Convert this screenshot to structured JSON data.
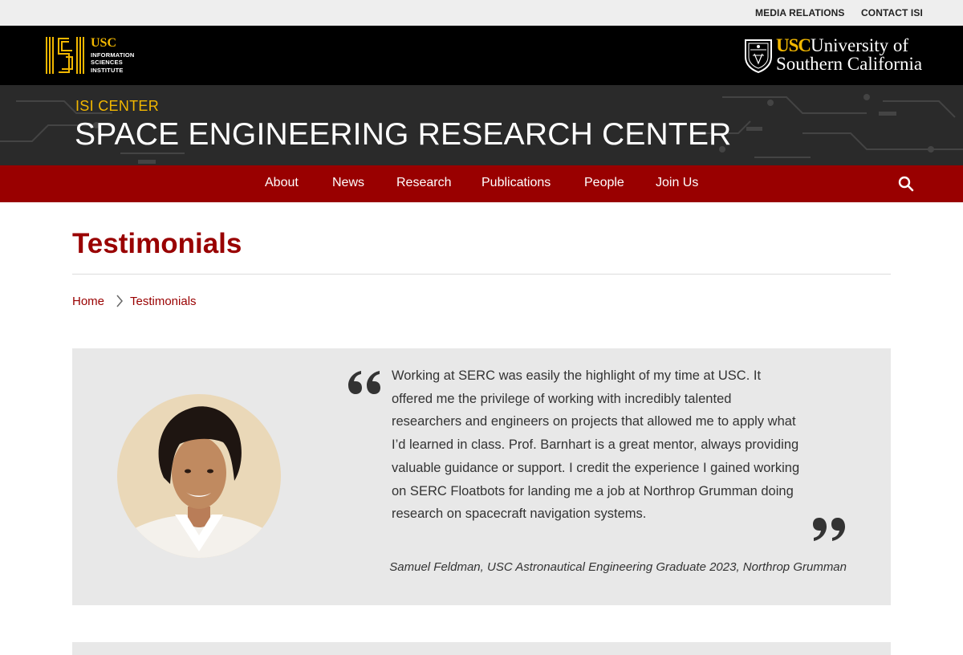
{
  "utility": {
    "media_relations": "MEDIA RELATIONS",
    "contact_isi": "CONTACT ISI"
  },
  "header": {
    "isi_logo": {
      "usc": "USC",
      "line1": "INFORMATION",
      "line2": "SCIENCES",
      "line3": "INSTITUTE"
    },
    "usc_logo": {
      "abbr": "USC",
      "line1": "University of",
      "line2": "Southern California"
    }
  },
  "banner": {
    "kicker": "ISI CENTER",
    "title": "SPACE ENGINEERING RESEARCH CENTER"
  },
  "nav": {
    "items": [
      {
        "label": "About"
      },
      {
        "label": "News"
      },
      {
        "label": "Research"
      },
      {
        "label": "Publications"
      },
      {
        "label": "People"
      },
      {
        "label": "Join Us"
      }
    ],
    "search_icon": "search-icon"
  },
  "page": {
    "title": "Testimonials"
  },
  "breadcrumb": {
    "home": "Home",
    "current": "Testimonials"
  },
  "testimonial": {
    "quote": "Working at SERC was easily the highlight of my time at USC. It offered me the privilege of working with incredibly talented researchers and engineers on projects that allowed me to apply what I’d learned in class. Prof. Barnhart is a great mentor, always providing valuable guidance or support. I credit the experience I gained working on SERC Floatbots for landing me a job at Northrop Grumman doing research on spacecraft navigation systems.",
    "author": "Samuel Feldman, USC Astronautical Engineering Graduate 2023, Northrop Grumman"
  },
  "colors": {
    "brand_red": "#990000",
    "gold": "#f2b700",
    "card_bg": "#e8e8e8"
  }
}
